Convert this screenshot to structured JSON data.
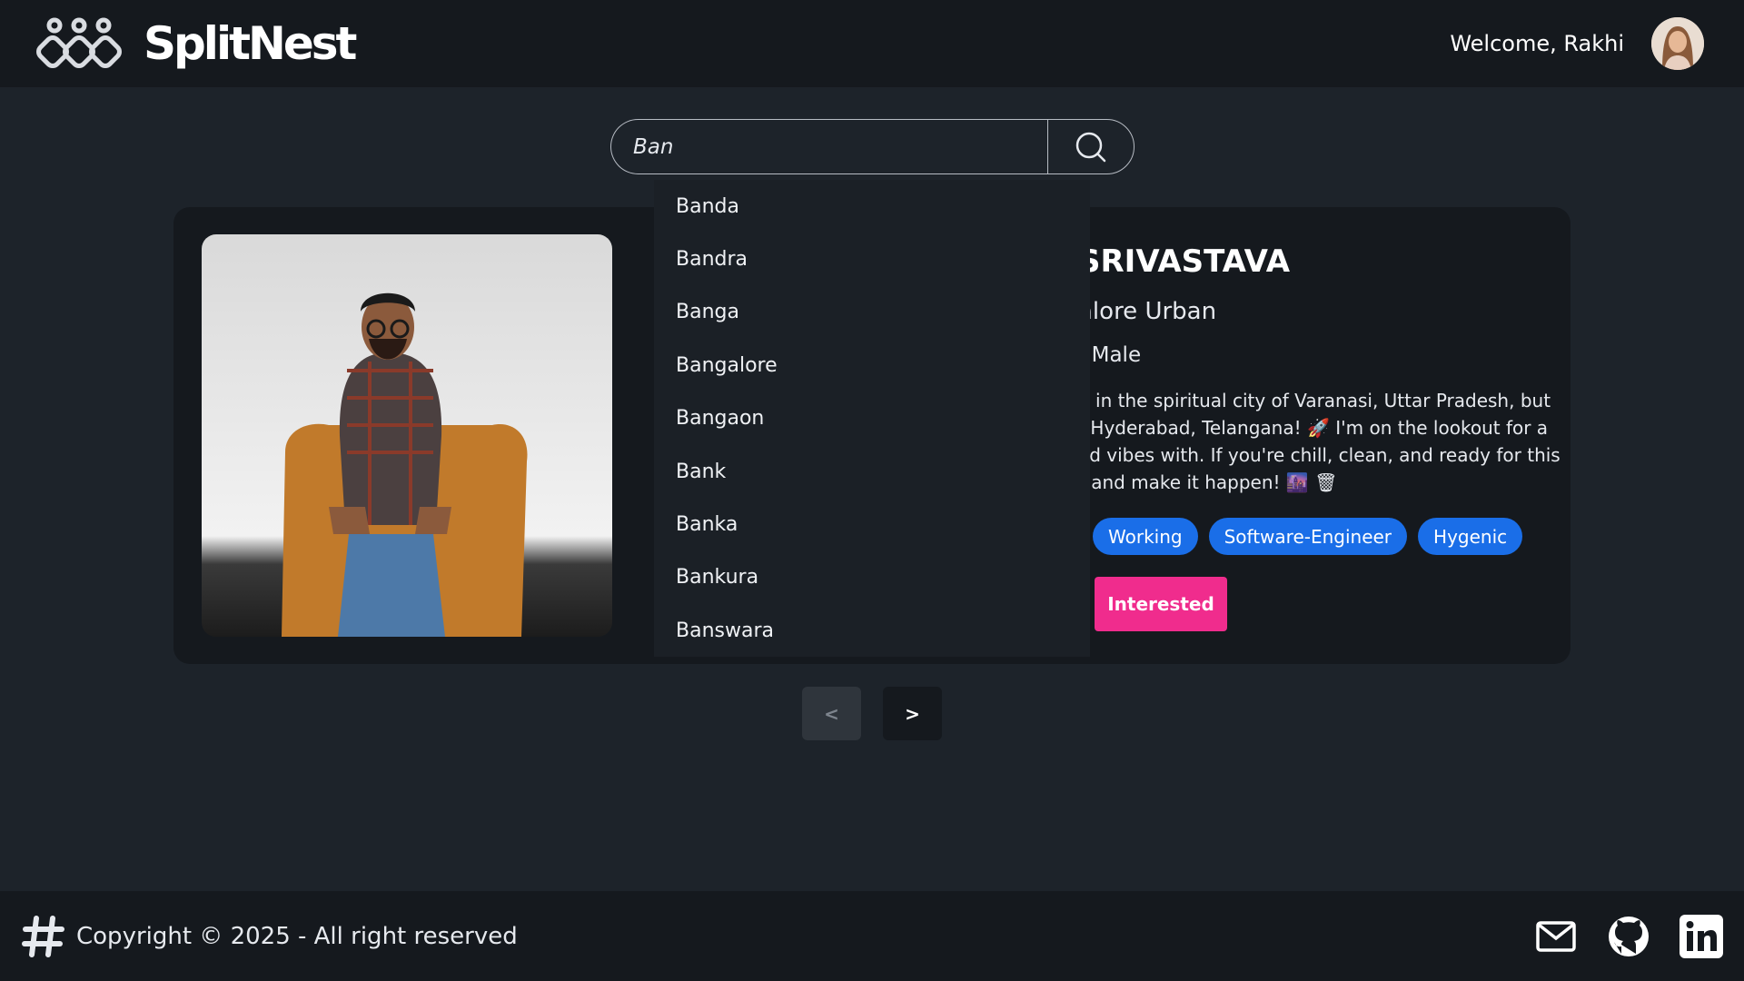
{
  "header": {
    "brand_name": "SplitNest",
    "welcome_text": "Welcome, Rakhi",
    "logo_icon": "interlocking-rings-logo",
    "avatar_icon": "user-avatar"
  },
  "search": {
    "value": "Ban",
    "button_icon": "search-icon"
  },
  "suggestions": [
    "Banda",
    "Bandra",
    "Banga",
    "Bangalore",
    "Bangaon",
    "Bank",
    "Banka",
    "Bankura",
    "Banswara"
  ],
  "profile": {
    "name": "SRIVASTAVA",
    "location": "alore Urban",
    "gender": ". Male",
    "bio_lines": [
      "d in the spiritual city of Varanasi, Uttar Pradesh, but",
      "f Hyderabad, Telangana! 🚀 I'm on the lookout for a",
      "od vibes with. If you're chill, clean, and ready for this",
      "t and make it happen! 🌆 🗑"
    ],
    "tags": [
      "Working",
      "Software-Engineer",
      "Hygenic"
    ],
    "interested_label": "Interested"
  },
  "pagination": {
    "prev_label": "<",
    "next_label": ">"
  },
  "footer": {
    "copyright": "Copyright © 2025 - All right reserved",
    "icons": [
      "hash-icon",
      "mail-icon",
      "github-icon",
      "linkedin-icon"
    ]
  },
  "colors": {
    "background": "#1d232a",
    "surface": "#15191e",
    "tag_blue": "#1a6ee8",
    "interested_pink": "#f02c8d"
  }
}
